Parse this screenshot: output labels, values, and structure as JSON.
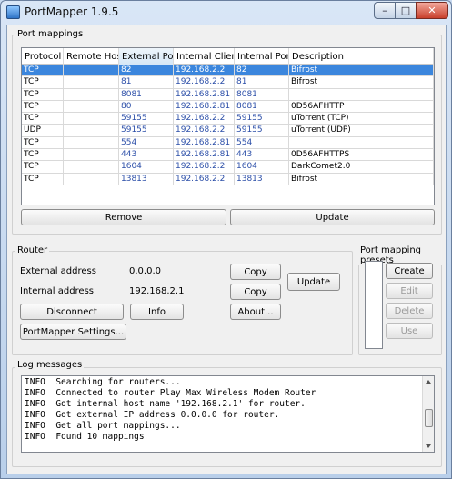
{
  "window": {
    "title": "PortMapper 1.9.5"
  },
  "port_mappings": {
    "section_label": "Port mappings",
    "columns": [
      "Protocol",
      "Remote Host",
      "External Port",
      "Internal Client",
      "Internal Port",
      "Description"
    ],
    "rows": [
      [
        "TCP",
        "",
        "82",
        "192.168.2.2",
        "82",
        "Bifrost"
      ],
      [
        "TCP",
        "",
        "81",
        "192.168.2.2",
        "81",
        "Bifrost"
      ],
      [
        "TCP",
        "",
        "8081",
        "192.168.2.81",
        "8081",
        ""
      ],
      [
        "TCP",
        "",
        "80",
        "192.168.2.81",
        "8081",
        "0D56AFHTTP"
      ],
      [
        "TCP",
        "",
        "59155",
        "192.168.2.2",
        "59155",
        "uTorrent (TCP)"
      ],
      [
        "UDP",
        "",
        "59155",
        "192.168.2.2",
        "59155",
        "uTorrent (UDP)"
      ],
      [
        "TCP",
        "",
        "554",
        "192.168.2.81",
        "554",
        ""
      ],
      [
        "TCP",
        "",
        "443",
        "192.168.2.81",
        "443",
        "0D56AFHTTPS"
      ],
      [
        "TCP",
        "",
        "1604",
        "192.168.2.2",
        "1604",
        "DarkComet2.0"
      ],
      [
        "TCP",
        "",
        "13813",
        "192.168.2.2",
        "13813",
        "Bifrost"
      ]
    ],
    "remove_label": "Remove",
    "update_label": "Update"
  },
  "router": {
    "section_label": "Router",
    "external_address_label": "External address",
    "external_address_value": "0.0.0.0",
    "internal_address_label": "Internal address",
    "internal_address_value": "192.168.2.1",
    "copy_label": "Copy",
    "update_label": "Update",
    "disconnect_label": "Disconnect",
    "info_label": "Info",
    "about_label": "About...",
    "settings_label": "PortMapper Settings..."
  },
  "presets": {
    "section_label": "Port mapping presets",
    "create_label": "Create",
    "edit_label": "Edit",
    "delete_label": "Delete",
    "use_label": "Use"
  },
  "log": {
    "section_label": "Log messages",
    "lines": [
      "INFO  Searching for routers...",
      "INFO  Connected to router Play Max Wireless Modem Router",
      "INFO  Got internal host name '192.168.2.1' for router.",
      "INFO  Got external IP address 0.0.0.0 for router.",
      "INFO  Get all port mappings...",
      "INFO  Found 10 mappings"
    ]
  }
}
